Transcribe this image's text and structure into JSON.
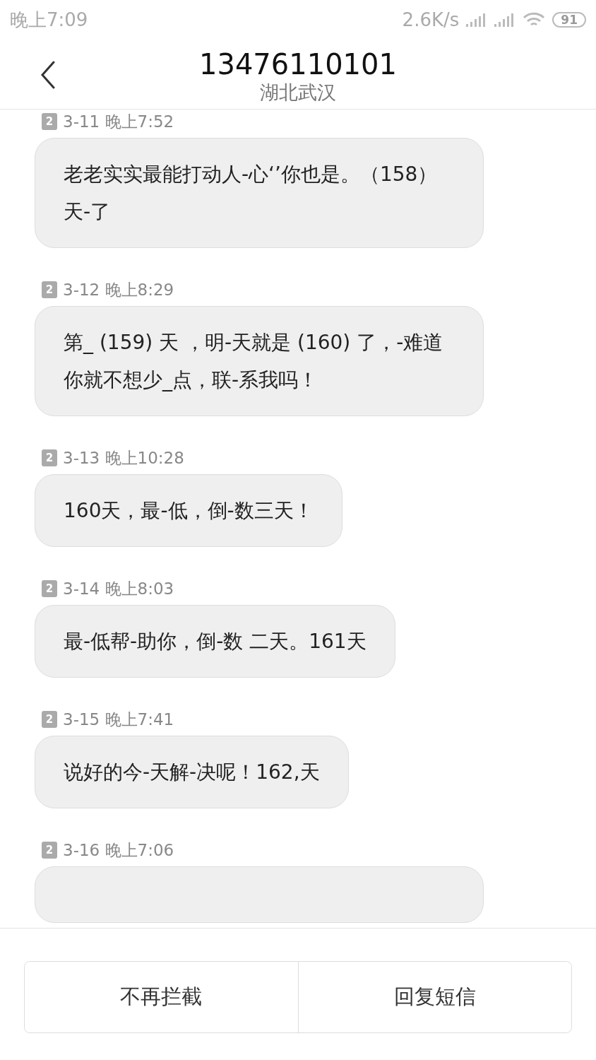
{
  "status_bar": {
    "time": "晚上7:09",
    "speed": "2.6K/s",
    "battery": "91"
  },
  "header": {
    "title": "13476110101",
    "subtitle": "湖北武汉"
  },
  "messages": [
    {
      "sim": "2",
      "time": "3-11 晚上7:52",
      "text": "老老实实最能打动人-心‘’你也是。（158）天-了"
    },
    {
      "sim": "2",
      "time": "3-12 晚上8:29",
      "text": "第_ (159) 天 ，明-天就是 (160) 了，-难道你就不想少_点，联-系我吗！"
    },
    {
      "sim": "2",
      "time": "3-13 晚上10:28",
      "text": "160天，最-低，倒-数三天！"
    },
    {
      "sim": "2",
      "time": "3-14 晚上8:03",
      "text": "最-低帮-助你，倒-数 二天。161天"
    },
    {
      "sim": "2",
      "time": "3-15 晚上7:41",
      "text": "说好的今-天解-决呢！162,天"
    },
    {
      "sim": "2",
      "time": "3-16 晚上7:06"
    }
  ],
  "buttons": [
    "不再拦截",
    "回复短信"
  ]
}
